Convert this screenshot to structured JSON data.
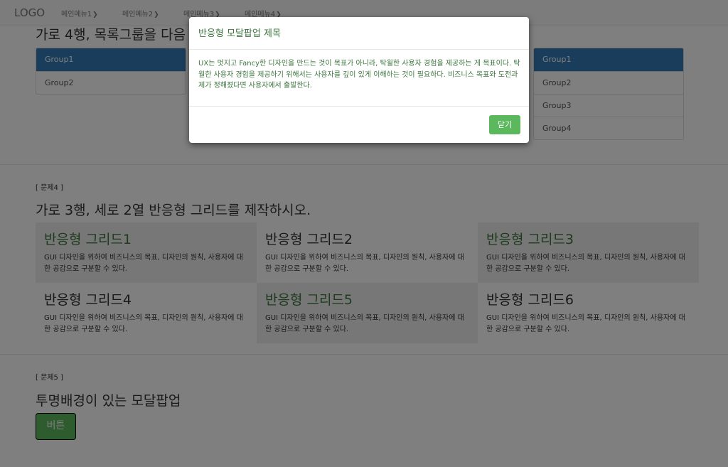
{
  "navbar": {
    "logo": "LOGO",
    "menus": [
      "메인메뉴1",
      "메인메뉴2",
      "메인메뉴3",
      "메인메뉴4"
    ]
  },
  "section3": {
    "heading": "가로 4행, 목록그룹을 다음",
    "left_group": [
      "Group1",
      "Group2"
    ],
    "right_group": [
      "Group1",
      "Group2",
      "Group3",
      "Group4"
    ]
  },
  "section4": {
    "label": "[ 문제4 ]",
    "heading": "가로 3행, 세로 2열 반응형 그리드를 제작하시오.",
    "cells": [
      {
        "title": "반응형 그리드1",
        "desc": "GUI 디자인을 위하여 비즈니스의 목표, 디자인의 원칙, 사용자에 대한 공감으로 구분할 수 있다."
      },
      {
        "title": "반응형 그리드2",
        "desc": "GUI 디자인을 위하여 비즈니스의 목표, 디자인의 원칙, 사용자에 대한 공감으로 구분할 수 있다."
      },
      {
        "title": "반응형 그리드3",
        "desc": "GUI 디자인을 위하여 비즈니스의 목표, 디자인의 원칙, 사용자에 대한 공감으로 구분할 수 있다."
      },
      {
        "title": "반응형 그리드4",
        "desc": "GUI 디자인을 위하여 비즈니스의 목표, 디자인의 원칙, 사용자에 대한 공감으로 구분할 수 있다."
      },
      {
        "title": "반응형 그리드5",
        "desc": "GUI 디자인을 위하여 비즈니스의 목표, 디자인의 원칙, 사용자에 대한 공감으로 구분할 수 있다."
      },
      {
        "title": "반응형 그리드6",
        "desc": "GUI 디자인을 위하여 비즈니스의 목표, 디자인의 원칙, 사용자에 대한 공감으로 구분할 수 있다."
      }
    ]
  },
  "section5": {
    "label": "[ 문제5 ]",
    "heading": "투명배경이 있는 모달팝업",
    "button": "버튼"
  },
  "modal": {
    "title": "반응형 모달팝업 제목",
    "body": "UX는 멋지고 Fancy한 디자인을 만드는 것이 목표가 아니라, 탁월한 사용자 경험을 제공하는 게 목표이다. 탁월한 사용자 경험을 제공하기 위해서는 사용자를 깊이 있게 이해하는 것이 필요하다. 비즈니스 목표와 도전과제가 정해졌다면 사용자에서 출발한다.",
    "close": "닫기"
  },
  "colors": {
    "primary": "#337ab7",
    "success": "#5cb85c",
    "green_text": "#3c763d",
    "cell_gray": "#eeeeee",
    "overlay": "rgba(0,0,0,0.5)"
  },
  "icons": {
    "menu_caret": "caret-down-icon"
  }
}
